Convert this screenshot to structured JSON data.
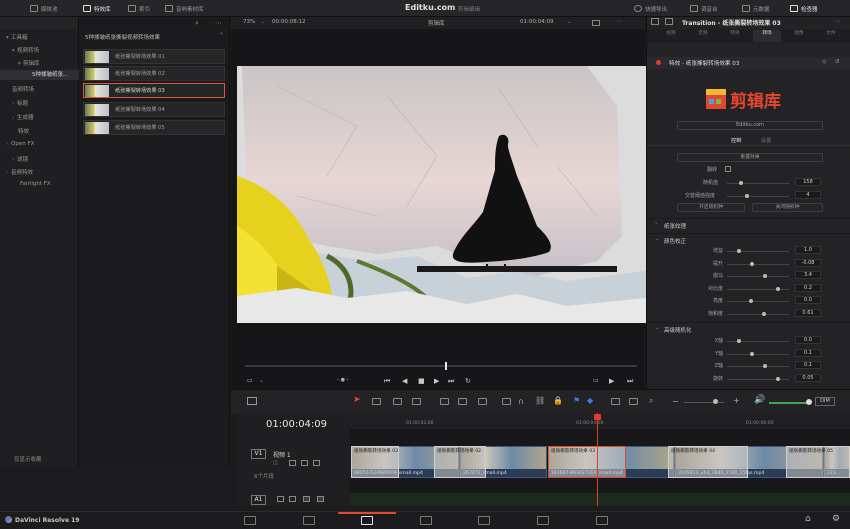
{
  "topbar": {
    "media_pool": "媒体池",
    "effects_library": "特效库",
    "index": "索引",
    "sound_library": "音响素材库",
    "site_title": "Editku.com",
    "site_subtitle": "剪辑编辑",
    "quick_export": "快捷导出",
    "mixer": "调音台",
    "metadata": "元数据",
    "inspector": "检查器"
  },
  "media_pool": {
    "items": [
      {
        "label": "工具箱"
      },
      {
        "label": "视频转场"
      },
      {
        "label": "剪辑库"
      },
      {
        "label": "5种揉皱纸张..."
      },
      {
        "label": "音频转场"
      },
      {
        "label": "标题"
      },
      {
        "label": "生成器"
      },
      {
        "label": "特效"
      },
      {
        "label": "Open FX"
      },
      {
        "label": "滤镜"
      },
      {
        "label": "音频特效"
      },
      {
        "label": "Fairlight FX"
      }
    ],
    "favorites": "仅显示收藏"
  },
  "clips_panel": {
    "title": "5种揉皱纸张撕裂视频转场效果",
    "clips": [
      {
        "name": "纸张撕裂转场效果 01"
      },
      {
        "name": "纸张撕裂转场效果 02"
      },
      {
        "name": "纸张撕裂转场效果 03"
      },
      {
        "name": "纸张撕裂转场效果 04"
      },
      {
        "name": "纸张撕裂转场效果 05"
      }
    ],
    "selected_index": 2
  },
  "viewer": {
    "zoom": "73%",
    "duration": "00:00:08:12",
    "title": "剪辑库",
    "timecode": "01:00:04:09"
  },
  "inspector": {
    "title": "Transition - 纸张撕裂转场效果 03",
    "tabs": [
      "视频",
      "音频",
      "特效",
      "转场",
      "图像",
      "文件"
    ],
    "active_tab": 3,
    "effect_name": "特效 - 纸张撕裂转场效果 03",
    "brand_name": "剪辑库",
    "url": "Editku.com",
    "sub_tabs": [
      "控制",
      "设置"
    ],
    "reset_button": "重置效果",
    "params_top": [
      {
        "label": "翻转",
        "value": ""
      },
      {
        "label": "随机值",
        "value": "158"
      },
      {
        "label": "交替阈值强度",
        "value": "4"
      }
    ],
    "btn_on": "开启随机种",
    "btn_off": "关闭随机种",
    "section_paper": "纸张纹理",
    "section_color": "颜色校正",
    "color_params": [
      {
        "label": "增益",
        "value": "1.0"
      },
      {
        "label": "提升",
        "value": "-0.08"
      },
      {
        "label": "伽马",
        "value": "3.4"
      },
      {
        "label": "对比度",
        "value": "0.2"
      },
      {
        "label": "亮度",
        "value": "0.0"
      },
      {
        "label": "饱和度",
        "value": "0.61"
      }
    ],
    "section_advanced": "高级随机化",
    "adv_params": [
      {
        "label": "X轴",
        "value": "0.0"
      },
      {
        "label": "Y轴",
        "value": "0.1"
      },
      {
        "label": "Z轴",
        "value": "0.1"
      },
      {
        "label": "旋转",
        "value": "0.05"
      }
    ]
  },
  "timeline": {
    "timecode": "01:00:04:09",
    "ruler": [
      "01:00:02:00",
      "01:00:04:00",
      "01:00:06:00"
    ],
    "dim_label": "DIM",
    "v1": {
      "label": "V1",
      "name": "视频 1",
      "count": "6个片段"
    },
    "a1": {
      "label": "A1"
    },
    "clips": [
      {
        "name": "68056-524689509_small.mp4"
      },
      {
        "name": "267472_small.mp4"
      },
      {
        "name": "191667-893427260_small.mp4"
      },
      {
        "name": "3195813_uhd_3840_2160_25fps.mp4"
      },
      {
        "name": "223..."
      }
    ],
    "transitions": [
      {
        "name": "纸张撕裂转场效果 03"
      },
      {
        "name": "纸张撕裂转场效果 02"
      },
      {
        "name": "纸张撕裂转场效果 03"
      },
      {
        "name": "纸张撕裂转场效果 04"
      },
      {
        "name": "纸张撕裂转场效果 05"
      }
    ]
  },
  "pagebar": {
    "brand": "DaVinci Resolve 19"
  }
}
